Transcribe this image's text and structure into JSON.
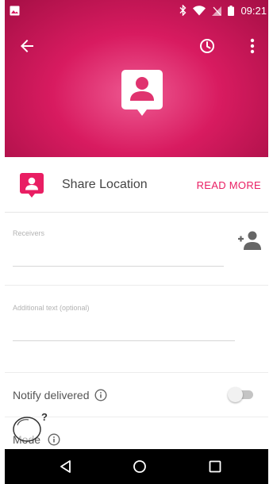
{
  "status_bar": {
    "time": "09:21",
    "icons": [
      "image-icon",
      "bluetooth-icon",
      "wifi-icon",
      "no-sim-icon",
      "battery-icon"
    ]
  },
  "header": {
    "background_color": "#d81b60",
    "accent_light": "#ee5a92",
    "icons": [
      "back-arrow-icon",
      "history-icon",
      "more-vert-icon",
      "contact-pin-icon"
    ]
  },
  "share": {
    "title": "Share Location",
    "read_more": "READ MORE",
    "accent": "#e91e63"
  },
  "receivers": {
    "label": "Receivers",
    "value": ""
  },
  "additional": {
    "label": "Additional text (optional)",
    "value": ""
  },
  "notify": {
    "label": "Notify delivered",
    "toggle_on": false
  },
  "mode": {
    "label": "Mode"
  },
  "nav": {
    "icons": [
      "back-triangle-icon",
      "home-circle-icon",
      "recents-square-icon"
    ]
  }
}
